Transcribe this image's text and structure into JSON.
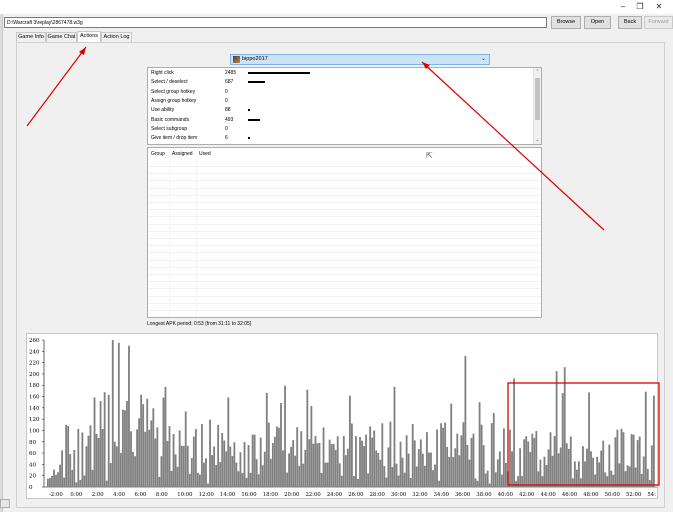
{
  "window": {
    "minimize_glyph": "–",
    "restore_glyph": "❐",
    "close_glyph": "✕"
  },
  "toolbar": {
    "path_value": "D:\\Warcraft 3\\replay\\2867478.w3g",
    "browse_label": "Browse",
    "open_label": "Open",
    "back_label": "Back",
    "forward_label": "Forward"
  },
  "tabs": [
    {
      "label": "Game Info"
    },
    {
      "label": "Game Chat"
    },
    {
      "label": "Actions"
    },
    {
      "label": "Action Log"
    }
  ],
  "player": {
    "selected": "bippo2017",
    "icon": "hero-portrait-icon"
  },
  "actions": [
    {
      "name": "Right click",
      "value": "2485",
      "count": 2485
    },
    {
      "name": "Select / deselect",
      "value": "687",
      "count": 687
    },
    {
      "name": "Select group hotkey",
      "value": "0",
      "count": 0
    },
    {
      "name": "Assign group hotkey",
      "value": "0",
      "count": 0
    },
    {
      "name": "Use ability",
      "value": "88",
      "count": 88
    },
    {
      "name": "Basic commands",
      "value": "493",
      "count": 493
    },
    {
      "name": "Select subgroup",
      "value": "0",
      "count": 0
    },
    {
      "name": "Give item / drop item",
      "value": "6",
      "count": 6
    }
  ],
  "group_table": {
    "columns": [
      "Group",
      "Assigned",
      "Used"
    ]
  },
  "apm_label": "Longest APK period: 0:53 (from 31:11 to 32:05)",
  "colors": {
    "bar": "#808080",
    "highlight": "#e00000",
    "selection": "#cce4f7"
  },
  "chart_data": {
    "type": "bar",
    "y_ticks": [
      "260",
      "240",
      "220",
      "200",
      "180",
      "160",
      "140",
      "120",
      "100",
      "80",
      "60",
      "40",
      "20",
      "0"
    ],
    "ylim": [
      0,
      260
    ],
    "x_ticks": [
      "-2:00",
      "0:00",
      "2:00",
      "4:00",
      "6:00",
      "8:00",
      "10:00",
      "12:00",
      "14:00",
      "16:00",
      "18:00",
      "20:00",
      "22:00",
      "24:00",
      "26:00",
      "28:00",
      "30:00",
      "32:00",
      "34:00",
      "36:00",
      "38:00",
      "40:00",
      "42:00",
      "44:00",
      "46:00",
      "48:00",
      "50:00",
      "52:00",
      "54:"
    ],
    "peaks": [
      {
        "x": "4:00",
        "value": 260
      },
      {
        "x": "4:30",
        "value": 255
      },
      {
        "x": "5:30",
        "value": 250
      },
      {
        "x": "36:30",
        "value": 232
      },
      {
        "x": "44:50",
        "value": 205
      },
      {
        "x": "45:40",
        "value": 212
      },
      {
        "x": "41:00",
        "value": 192
      }
    ]
  }
}
